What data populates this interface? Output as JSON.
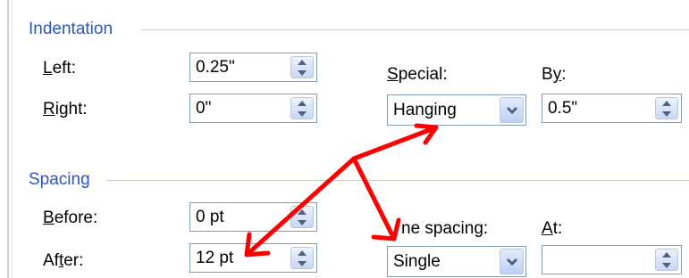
{
  "indentation": {
    "title": "Indentation",
    "left": {
      "label": "Left:",
      "key": "L",
      "rest": "eft:",
      "value": "0.25\""
    },
    "right": {
      "label": "Right:",
      "key": "R",
      "rest": "ight:",
      "value": "0\""
    },
    "special": {
      "label": "Special:",
      "key": "S",
      "rest": "pecial:",
      "value": "Hanging"
    },
    "by": {
      "label": "By:",
      "pre": "B",
      "key": "y",
      "rest": ":",
      "value": "0.5\""
    }
  },
  "spacing": {
    "title": "Spacing",
    "before": {
      "label": "Before:",
      "key": "B",
      "rest": "efore:",
      "value": "0 pt"
    },
    "after": {
      "label": "After:",
      "pre": "Af",
      "key": "t",
      "rest": "er:",
      "value": "12 pt"
    },
    "line_spacing": {
      "label": "ine spacing:",
      "pre": "",
      "key": "",
      "rest": "ne spacing:",
      "value": "Single"
    },
    "at": {
      "label": "At:",
      "key": "A",
      "rest": "t:",
      "value": ""
    }
  },
  "annotation": {
    "color": "#ff0000"
  },
  "colors": {
    "section_title": "#2b55c4",
    "field_border": "#7f9db9"
  }
}
